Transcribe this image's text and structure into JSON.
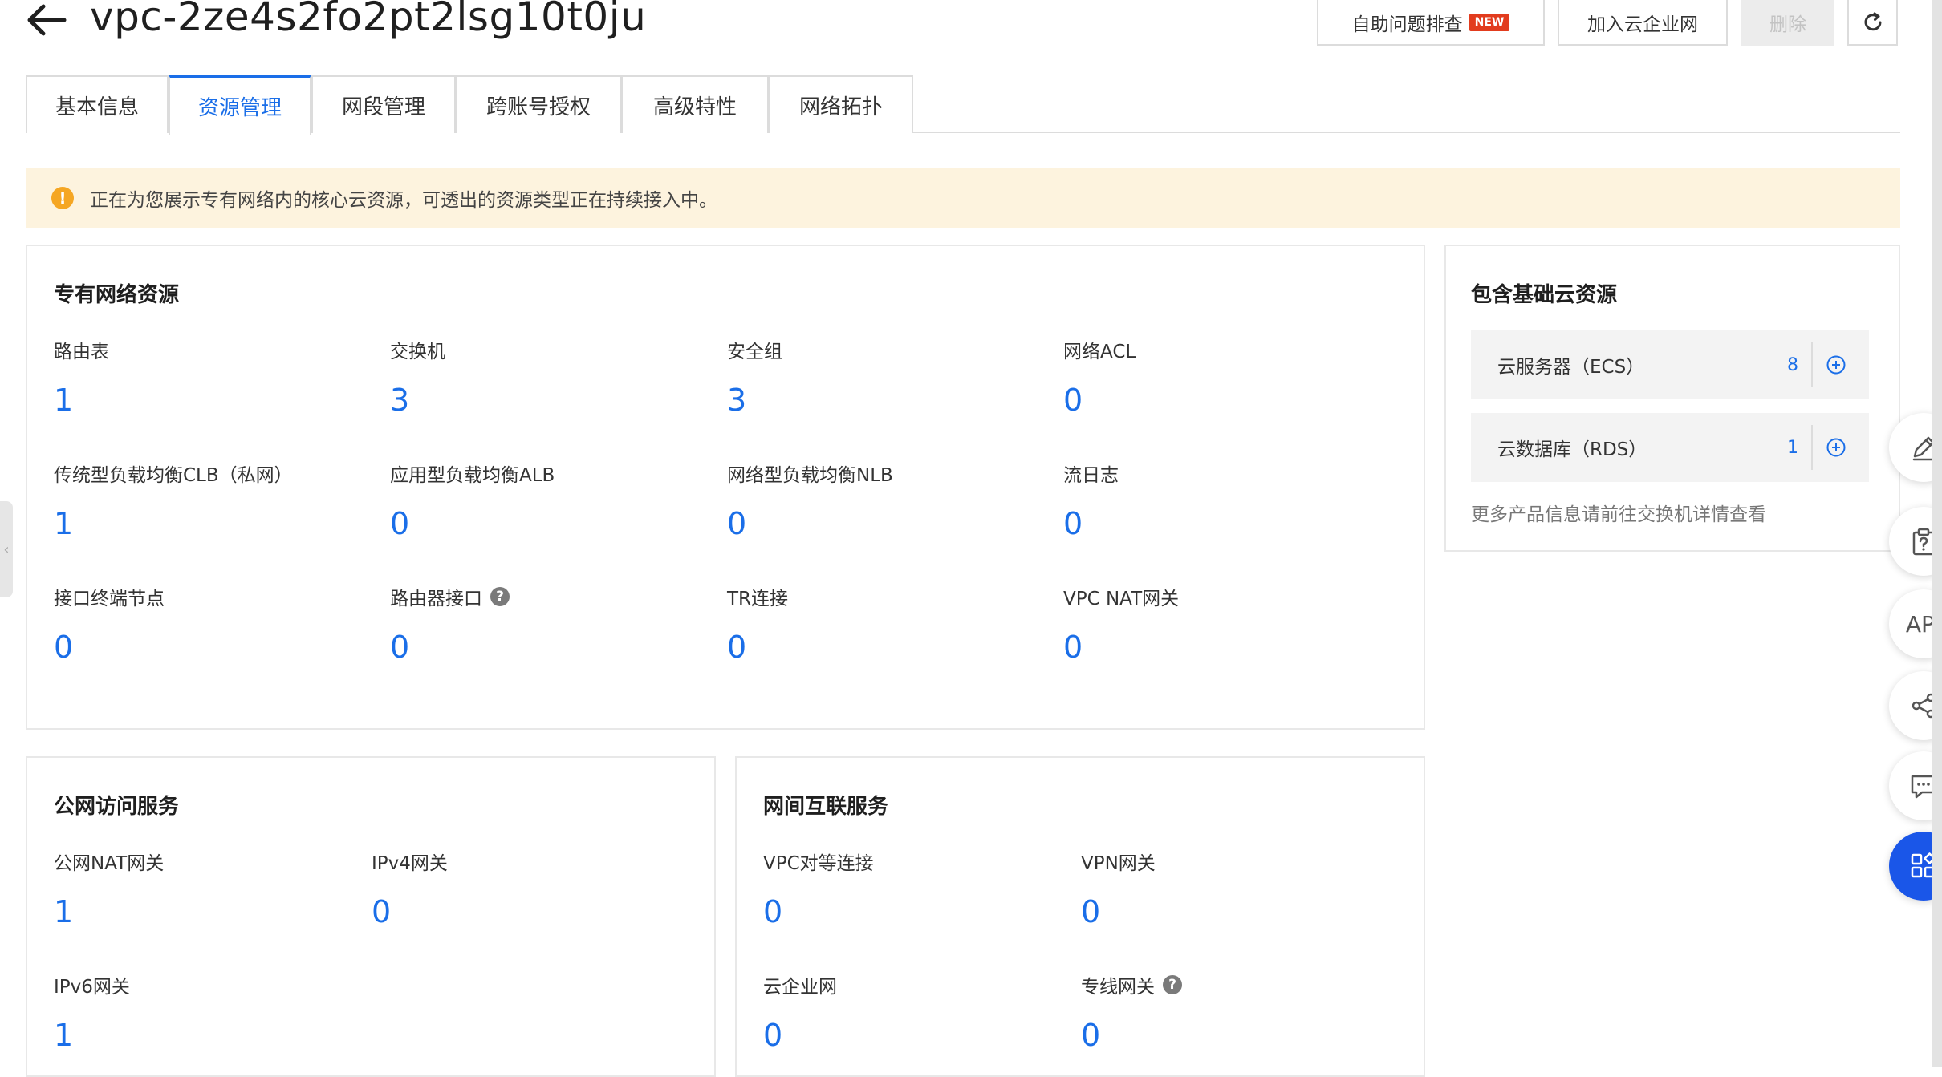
{
  "header": {
    "title": "vpc-2ze4s2fo2pt2lsg10t0ju",
    "buttons": {
      "troubleshoot": "自助问题排查",
      "new_badge": "NEW",
      "join_cen": "加入云企业网",
      "delete": "删除"
    }
  },
  "tabs": [
    {
      "label": "基本信息"
    },
    {
      "label": "资源管理"
    },
    {
      "label": "网段管理"
    },
    {
      "label": "跨账号授权"
    },
    {
      "label": "高级特性"
    },
    {
      "label": "网络拓扑"
    }
  ],
  "active_tab": "资源管理",
  "notice": {
    "text": "正在为您展示专有网络内的核心云资源，可透出的资源类型正在持续接入中。"
  },
  "vpc_resources": {
    "title": "专有网络资源",
    "items": [
      {
        "label": "路由表",
        "value": "1"
      },
      {
        "label": "交换机",
        "value": "3"
      },
      {
        "label": "安全组",
        "value": "3"
      },
      {
        "label": "网络ACL",
        "value": "0"
      },
      {
        "label": "传统型负载均衡CLB（私网）",
        "value": "1"
      },
      {
        "label": "应用型负载均衡ALB",
        "value": "0"
      },
      {
        "label": "网络型负载均衡NLB",
        "value": "0"
      },
      {
        "label": "流日志",
        "value": "0"
      },
      {
        "label": "接口终端节点",
        "value": "0"
      },
      {
        "label": "路由器接口",
        "value": "0"
      },
      {
        "label": "TR连接",
        "value": "0"
      },
      {
        "label": "VPC NAT网关",
        "value": "0"
      }
    ]
  },
  "cloud_resources": {
    "title": "包含基础云资源",
    "items": [
      {
        "label": "云服务器（ECS）",
        "value": "8"
      },
      {
        "label": "云数据库（RDS）",
        "value": "1"
      }
    ],
    "more": "更多产品信息请前往交换机详情查看"
  },
  "public_access": {
    "title": "公网访问服务",
    "items": [
      {
        "label": "公网NAT网关",
        "value": "1"
      },
      {
        "label": "IPv4网关",
        "value": "0"
      },
      {
        "label": "IPv6网关",
        "value": "1"
      }
    ]
  },
  "interconnect": {
    "title": "网间互联服务",
    "items": [
      {
        "label": "VPC对等连接",
        "value": "0"
      },
      {
        "label": "VPN网关",
        "value": "0"
      },
      {
        "label": "云企业网",
        "value": "0"
      },
      {
        "label": "专线网关",
        "value": "0"
      }
    ]
  },
  "toolbar": {
    "api_label": "API"
  },
  "colors": {
    "accent": "#1a6ee8",
    "notice_bg": "#fdf3de",
    "warning": "#f5a623",
    "new_badge": "#e23c1e"
  }
}
